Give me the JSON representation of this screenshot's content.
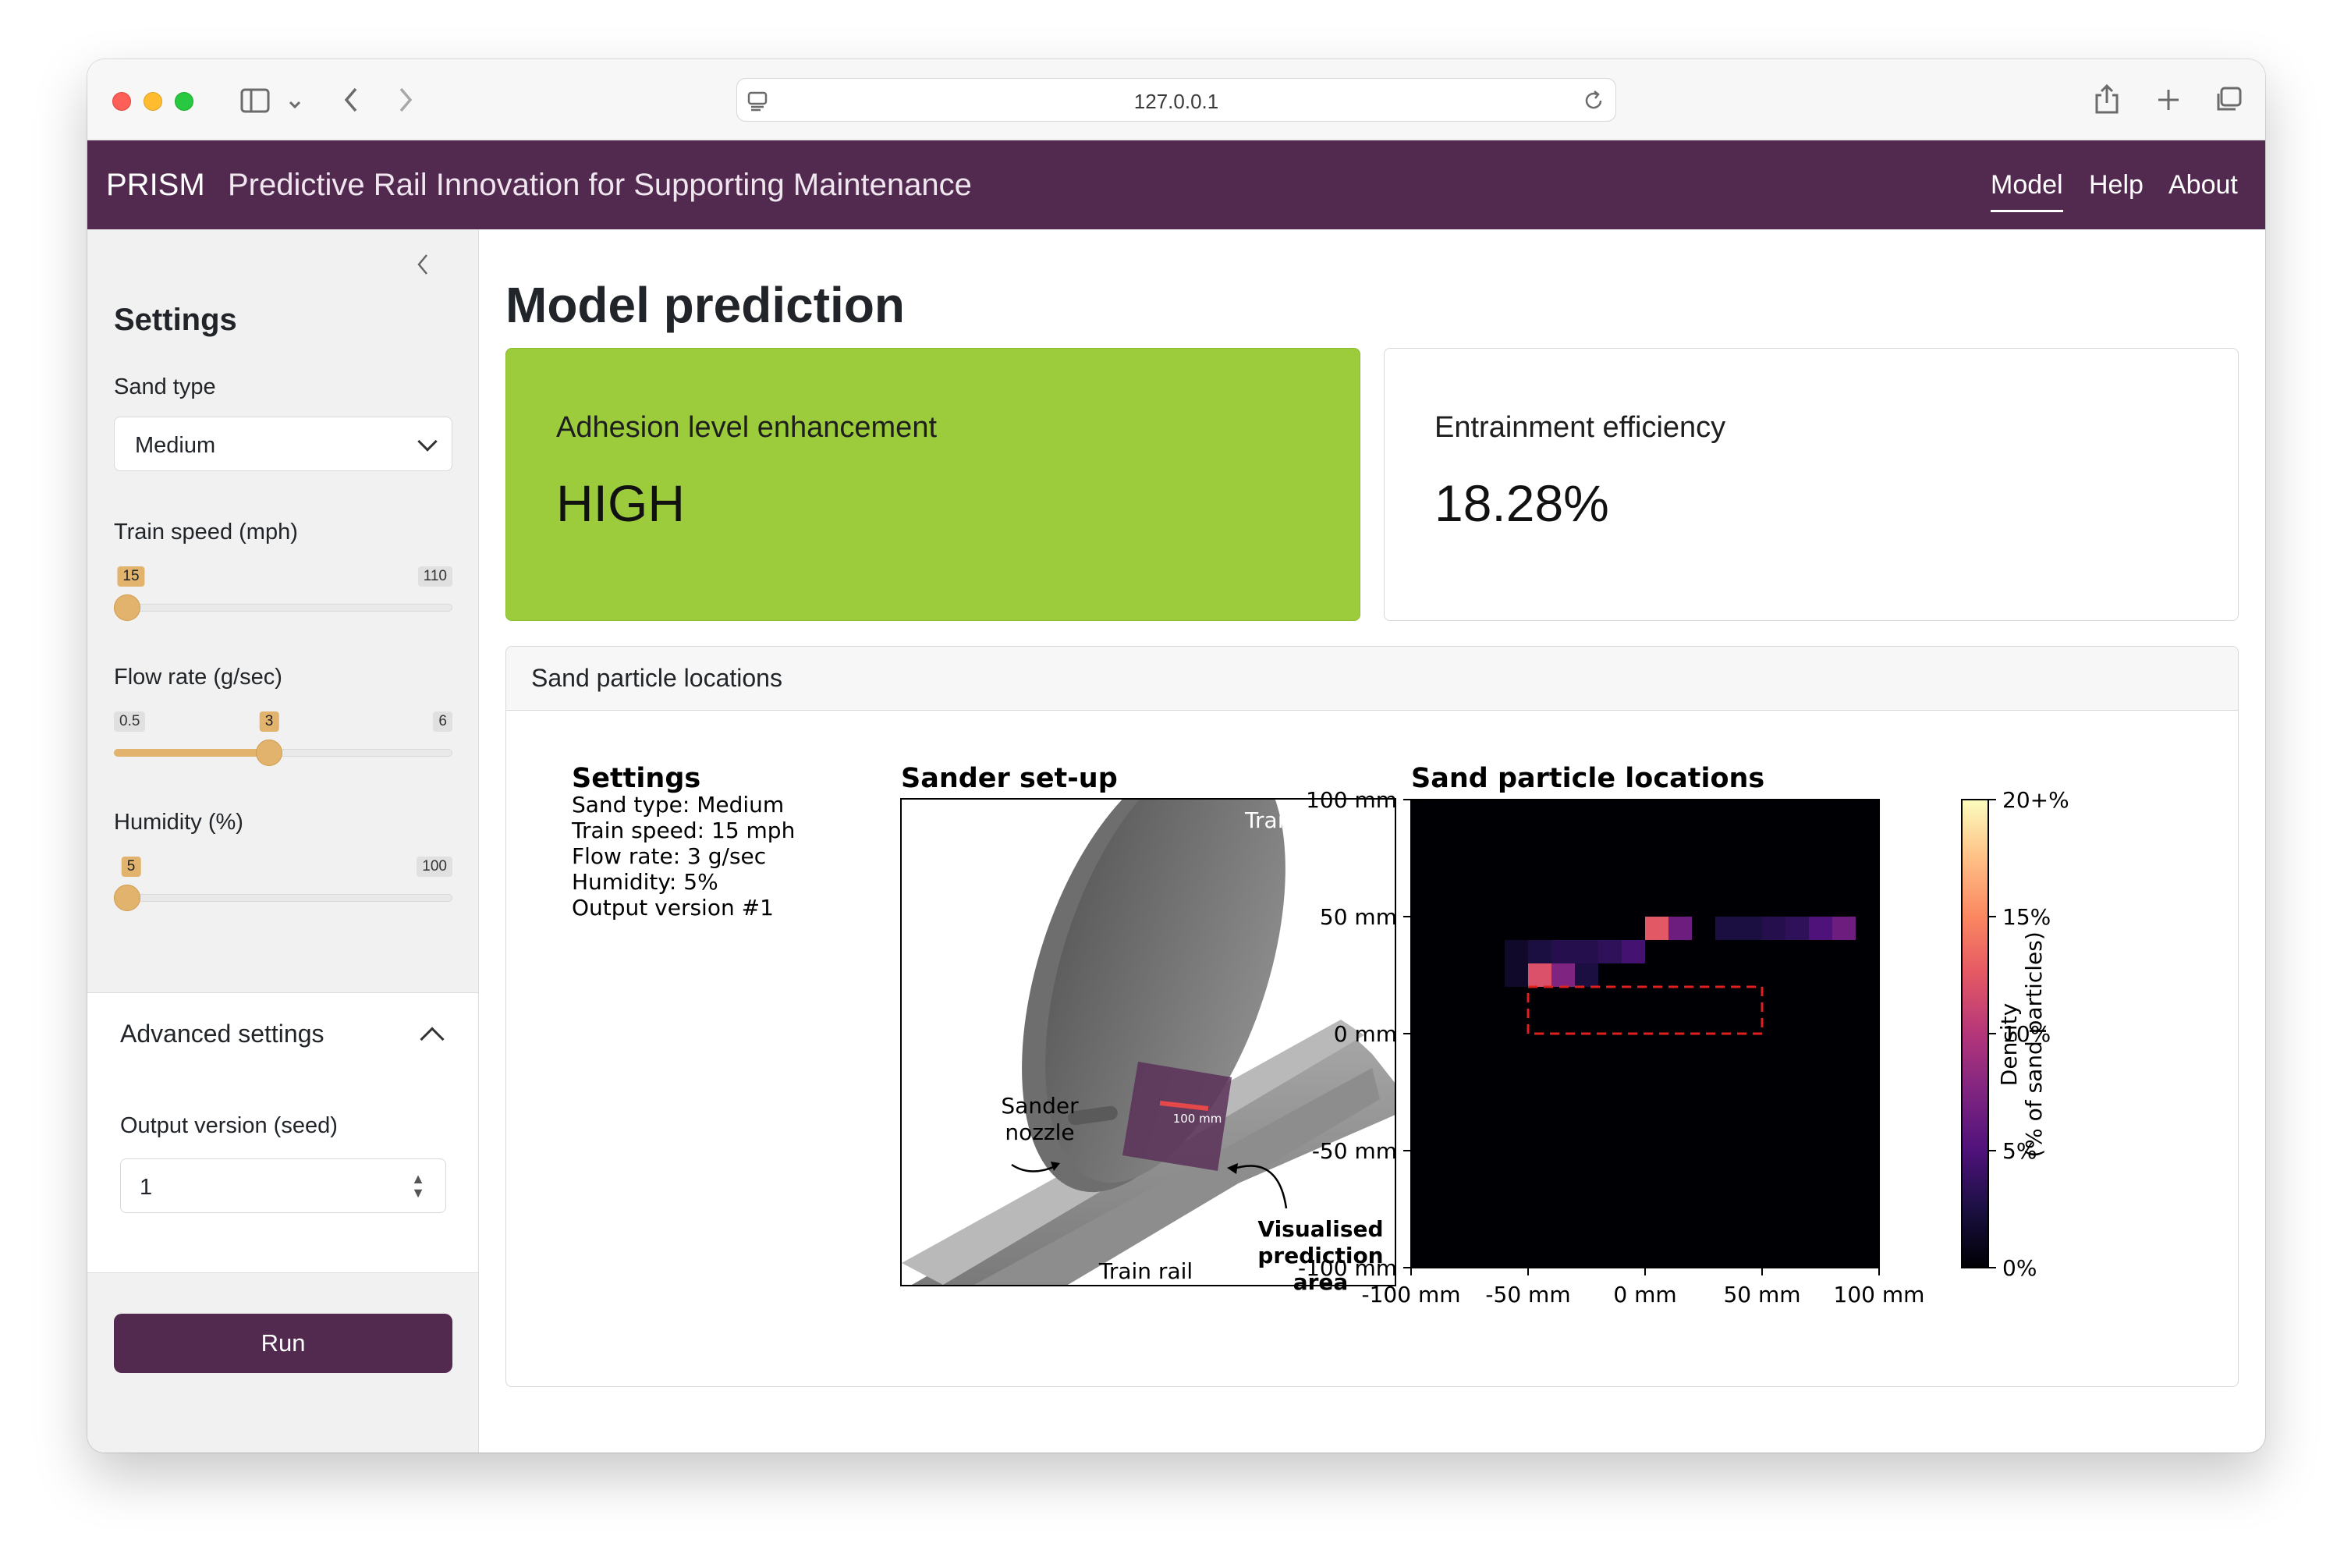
{
  "browser": {
    "url": "127.0.0.1",
    "icons": [
      "sidebar-icon",
      "chevron-down-icon",
      "back-icon",
      "forward-icon",
      "site-icon",
      "reload-icon",
      "share-icon",
      "new-tab-icon",
      "tabs-icon"
    ]
  },
  "navbar": {
    "brand": "PRISM",
    "subtitle": "Predictive Rail Innovation for Supporting Maintenance",
    "links": [
      "Model",
      "Help",
      "About"
    ],
    "active": "Model"
  },
  "sidebar": {
    "title": "Settings",
    "sand_type": {
      "label": "Sand type",
      "value": "Medium"
    },
    "train_speed": {
      "label": "Train speed (mph)",
      "min": "15",
      "max": "110",
      "value": "15",
      "fraction": 0.0
    },
    "flow_rate": {
      "label": "Flow rate (g/sec)",
      "min": "0.5",
      "max": "6",
      "value": "3",
      "fraction": 0.4545
    },
    "humidity": {
      "label": "Humidity (%)",
      "min": "5",
      "max": "100",
      "value": "5",
      "fraction": 0.0
    },
    "advanced": {
      "title": "Advanced settings",
      "seed_label": "Output version (seed)",
      "seed_value": "1"
    },
    "run_label": "Run",
    "accent_color": "#e2b36d"
  },
  "main": {
    "title": "Model prediction",
    "adhesion": {
      "label": "Adhesion level enhancement",
      "value": "HIGH",
      "color": "#9ccc3c"
    },
    "entrainment": {
      "label": "Entrainment efficiency",
      "value": "18.28%"
    },
    "panel_title": "Sand particle locations"
  },
  "figure": {
    "settings_title": "Settings",
    "settings_lines": [
      "Sand type: Medium",
      "Train speed: 15 mph",
      "Flow rate: 3 g/sec",
      "Humidity: 5%",
      "Output version #1"
    ],
    "setup_title": "Sander set-up",
    "labels": {
      "train_wheel": "Train wheel",
      "sander_nozzle": [
        "Sander",
        "nozzle"
      ],
      "scale": "100 mm",
      "visualised": [
        "Visualised",
        "prediction",
        "area"
      ],
      "train_rail": "Train rail"
    },
    "heatmap_title": "Sand particle locations",
    "colorbar_label": [
      "Density",
      "(% of sand particles)"
    ],
    "colorbar_ticks": [
      "0%",
      "5%",
      "10%",
      "15%",
      "20+%"
    ]
  },
  "chart_data": {
    "type": "heatmap",
    "title": "Sand particle locations",
    "xlabel": "",
    "ylabel": "",
    "xlim": [
      -100,
      100
    ],
    "ylim": [
      -100,
      100
    ],
    "x_ticks": [
      "-100 mm",
      "-50 mm",
      "0 mm",
      "50 mm",
      "100 mm"
    ],
    "x_tick_values": [
      -100,
      -50,
      0,
      50,
      100
    ],
    "y_ticks": [
      "-100 mm",
      "-50 mm",
      "0 mm",
      "50 mm",
      "100 mm"
    ],
    "y_tick_values": [
      -100,
      -50,
      0,
      50,
      100
    ],
    "colorbar_range": [
      0,
      20
    ],
    "cell_size": 10,
    "cells": [
      {
        "x": -60,
        "y": 30,
        "value": 1.5
      },
      {
        "x": -50,
        "y": 30,
        "value": 2.5
      },
      {
        "x": -40,
        "y": 30,
        "value": 3.0
      },
      {
        "x": -30,
        "y": 30,
        "value": 3.0
      },
      {
        "x": -20,
        "y": 30,
        "value": 3.5
      },
      {
        "x": -10,
        "y": 30,
        "value": 4.5
      },
      {
        "x": 0,
        "y": 40,
        "value": 12.5
      },
      {
        "x": 10,
        "y": 40,
        "value": 6.5
      },
      {
        "x": 30,
        "y": 40,
        "value": 2.5
      },
      {
        "x": 40,
        "y": 40,
        "value": 2.5
      },
      {
        "x": 50,
        "y": 40,
        "value": 3.0
      },
      {
        "x": 60,
        "y": 40,
        "value": 3.5
      },
      {
        "x": 70,
        "y": 40,
        "value": 5.0
      },
      {
        "x": 80,
        "y": 40,
        "value": 6.5
      },
      {
        "x": -60,
        "y": 20,
        "value": 1.5
      },
      {
        "x": -50,
        "y": 20,
        "value": 12.0
      },
      {
        "x": -40,
        "y": 20,
        "value": 7.5
      },
      {
        "x": -30,
        "y": 20,
        "value": 2.5
      }
    ],
    "target_region": {
      "x": [
        -50,
        50
      ],
      "y": [
        0,
        20
      ]
    }
  }
}
